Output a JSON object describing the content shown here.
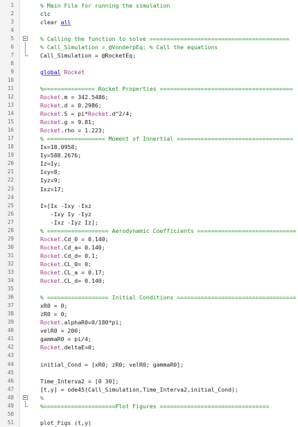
{
  "editor": {
    "lines": [
      {
        "n": "1",
        "parts": [
          {
            "t": "% Main File for running the simulation",
            "c": "comment"
          }
        ]
      },
      {
        "n": "2",
        "parts": [
          {
            "t": "clc",
            "c": "plain"
          }
        ]
      },
      {
        "n": "3",
        "parts": [
          {
            "t": "clear ",
            "c": "plain"
          },
          {
            "t": "all",
            "c": "keyword"
          }
        ]
      },
      {
        "n": "4",
        "parts": []
      },
      {
        "n": "5",
        "fold": true,
        "parts": [
          {
            "t": "% Calling the function to solve =========================================",
            "c": "comment"
          }
        ]
      },
      {
        "n": "6",
        "parts": [
          {
            "t": "% Call_Simulation = @VonderpEq; % Call the equations",
            "c": "comment"
          }
        ]
      },
      {
        "n": "7",
        "parts": [
          {
            "t": "Call_Simulation = @RocketEq;",
            "c": "plain"
          }
        ]
      },
      {
        "n": "8",
        "parts": []
      },
      {
        "n": "9",
        "parts": [
          {
            "t": "global",
            "c": "keyword"
          },
          {
            "t": " Rocket",
            "c": "ident"
          }
        ]
      },
      {
        "n": "10",
        "parts": []
      },
      {
        "n": "11",
        "parts": [
          {
            "t": "%=============== Rocket Properties =======================================",
            "c": "comment"
          }
        ]
      },
      {
        "n": "12",
        "parts": [
          {
            "t": "Rocket",
            "c": "ident"
          },
          {
            "t": ".m = 342.5486;",
            "c": "plain"
          }
        ]
      },
      {
        "n": "13",
        "parts": [
          {
            "t": "Rocket",
            "c": "ident"
          },
          {
            "t": ".d = 0.2986;",
            "c": "plain"
          }
        ]
      },
      {
        "n": "14",
        "parts": [
          {
            "t": "Rocket",
            "c": "ident"
          },
          {
            "t": ".S = pi*",
            "c": "plain"
          },
          {
            "t": "Rocket",
            "c": "ident"
          },
          {
            "t": ".d^2/4;",
            "c": "plain"
          }
        ]
      },
      {
        "n": "15",
        "parts": [
          {
            "t": "Rocket",
            "c": "ident"
          },
          {
            "t": ".g = 9.81;",
            "c": "plain"
          }
        ]
      },
      {
        "n": "16",
        "parts": [
          {
            "t": "Rocket",
            "c": "ident"
          },
          {
            "t": ".rho = 1.223;",
            "c": "plain"
          }
        ]
      },
      {
        "n": "17",
        "parts": [
          {
            "t": "% ================= Moment of Innertial ==================================",
            "c": "comment"
          }
        ]
      },
      {
        "n": "18",
        "parts": [
          {
            "t": "Ix=18.0958;",
            "c": "plain"
          }
        ]
      },
      {
        "n": "19",
        "parts": [
          {
            "t": "Iy=588.2676;",
            "c": "plain"
          }
        ]
      },
      {
        "n": "20",
        "parts": [
          {
            "t": "Iz=Iy;",
            "c": "plain"
          }
        ]
      },
      {
        "n": "21",
        "parts": [
          {
            "t": "Ixy=8;",
            "c": "plain"
          }
        ]
      },
      {
        "n": "22",
        "parts": [
          {
            "t": "Iyz=9;",
            "c": "plain"
          }
        ]
      },
      {
        "n": "23",
        "parts": [
          {
            "t": "Ixz=17;",
            "c": "plain"
          }
        ]
      },
      {
        "n": "24",
        "parts": []
      },
      {
        "n": "25",
        "parts": [
          {
            "t": "I=[Ix -Ixy -Ixz",
            "c": "plain"
          }
        ]
      },
      {
        "n": "26",
        "parts": [
          {
            "t": "   -Ixy Iy -Iyz",
            "c": "plain"
          }
        ]
      },
      {
        "n": "27",
        "parts": [
          {
            "t": "   -Ixz -Iyz Iz];",
            "c": "plain"
          }
        ]
      },
      {
        "n": "28",
        "parts": [
          {
            "t": "% ================== Aerodynamic Coefficients =============================",
            "c": "comment"
          }
        ]
      },
      {
        "n": "29",
        "parts": [
          {
            "t": "Rocket",
            "c": "ident"
          },
          {
            "t": ".Cd_0 = 0.140;",
            "c": "plain"
          }
        ]
      },
      {
        "n": "30",
        "parts": [
          {
            "t": "Rocket",
            "c": "ident"
          },
          {
            "t": ".Cd_a= 0.140;",
            "c": "plain"
          }
        ]
      },
      {
        "n": "31",
        "parts": [
          {
            "t": "Rocket",
            "c": "ident"
          },
          {
            "t": ".Cd_d= 0.1;",
            "c": "plain"
          }
        ]
      },
      {
        "n": "32",
        "parts": [
          {
            "t": "Rocket",
            "c": "ident"
          },
          {
            "t": ".CL_0= 0;",
            "c": "plain"
          }
        ]
      },
      {
        "n": "33",
        "parts": [
          {
            "t": "Rocket",
            "c": "ident"
          },
          {
            "t": ".CL_a = 0.17;",
            "c": "plain"
          }
        ]
      },
      {
        "n": "34",
        "parts": [
          {
            "t": "Rocket",
            "c": "ident"
          },
          {
            "t": ".CL_d= 0.140;",
            "c": "plain"
          }
        ]
      },
      {
        "n": "35",
        "parts": []
      },
      {
        "n": "36",
        "parts": [
          {
            "t": "% ================== Initial Conditions ===================================",
            "c": "comment"
          }
        ]
      },
      {
        "n": "37",
        "parts": [
          {
            "t": "xR0 = 0;",
            "c": "plain"
          }
        ]
      },
      {
        "n": "38",
        "parts": [
          {
            "t": "zR0 = 0;",
            "c": "plain"
          }
        ]
      },
      {
        "n": "39",
        "parts": [
          {
            "t": "Rocket",
            "c": "ident"
          },
          {
            "t": ".alphaR0=0/180*pi;",
            "c": "plain"
          }
        ]
      },
      {
        "n": "40",
        "parts": [
          {
            "t": "velR0 = 200;",
            "c": "plain"
          }
        ]
      },
      {
        "n": "41",
        "parts": [
          {
            "t": "gammaR0 = pi/4;",
            "c": "plain"
          }
        ]
      },
      {
        "n": "42",
        "parts": [
          {
            "t": "Rocket",
            "c": "ident"
          },
          {
            "t": ".deltaE=0;",
            "c": "plain"
          }
        ]
      },
      {
        "n": "43",
        "parts": []
      },
      {
        "n": "44",
        "parts": [
          {
            "t": "initial_Cond = [xR0; zR0; velR0; gammaR0];",
            "c": "plain"
          }
        ]
      },
      {
        "n": "45",
        "parts": []
      },
      {
        "n": "46",
        "parts": [
          {
            "t": "Time_Interva2 = [0 30];",
            "c": "plain"
          }
        ]
      },
      {
        "n": "47",
        "parts": [
          {
            "t": "[t,y] = ode45(Call_Simulation,Time_Interva2,initial_Cond);",
            "c": "plain"
          }
        ]
      },
      {
        "n": "48",
        "fold": true,
        "parts": [
          {
            "t": "%",
            "c": "comment"
          }
        ]
      },
      {
        "n": "49",
        "parts": [
          {
            "t": "%=====================Plot Figures ================================",
            "c": "comment"
          }
        ]
      },
      {
        "n": "50",
        "parts": []
      },
      {
        "n": "51",
        "parts": [
          {
            "t": "plot_Figs (t,y)",
            "c": "plain"
          }
        ]
      }
    ]
  }
}
